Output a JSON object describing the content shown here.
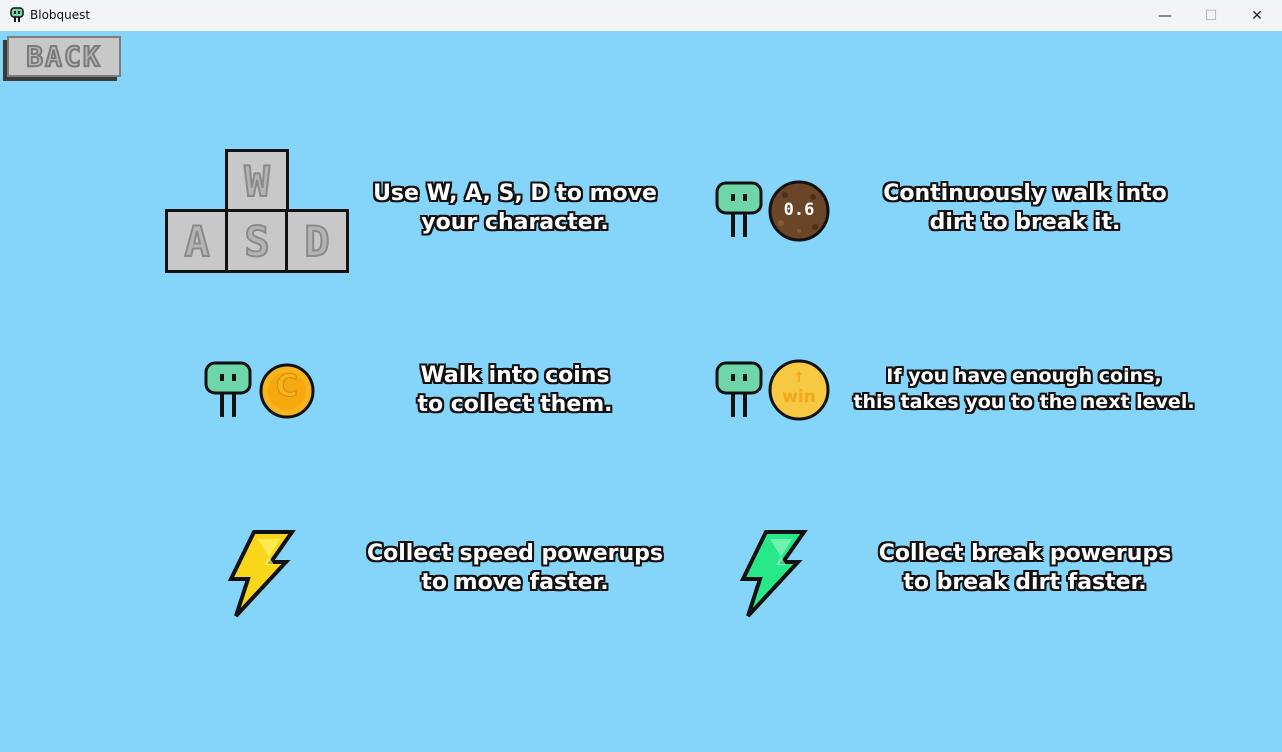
{
  "window": {
    "title": "Blobquest",
    "minimize_glyph": "—",
    "maximize_glyph": "☐",
    "close_glyph": "✕"
  },
  "back_button": {
    "label": "BACK"
  },
  "keys": {
    "w": "W",
    "a": "A",
    "s": "S",
    "d": "D"
  },
  "dirt": {
    "value": "0.6"
  },
  "coin": {
    "letter": "C"
  },
  "win_coin": {
    "arrow": "↑",
    "label": "win"
  },
  "instructions": {
    "move": {
      "line1": "Use W, A, S, D to move",
      "line2": "your character."
    },
    "dirt": {
      "line1": "Continuously walk into",
      "line2": "dirt to break it."
    },
    "coins": {
      "line1": "Walk into coins",
      "line2": "to collect them."
    },
    "win": {
      "line1": "If you have enough coins,",
      "line2": "this takes you to the next level."
    },
    "speed": {
      "line1": "Collect speed powerups",
      "line2": "to move faster."
    },
    "break": {
      "line1": "Collect break powerups",
      "line2": "to break dirt faster."
    }
  },
  "colors": {
    "sky": "#85d4f9",
    "blob": "#6fd6a9",
    "dirt": "#6b4527",
    "coin": "#f7b51c",
    "speed_bolt": "#f8d61a",
    "break_bolt": "#27e98a"
  }
}
